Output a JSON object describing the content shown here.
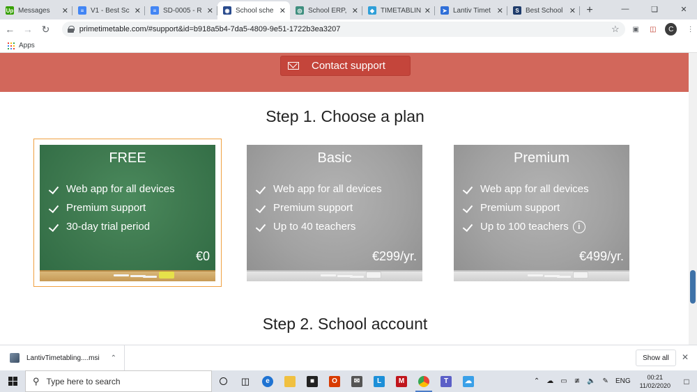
{
  "browser": {
    "tabs": [
      {
        "title": "Messages",
        "icon": "upwork-icon",
        "icon_text": "Up",
        "color": "#37a000",
        "active": false
      },
      {
        "title": "V1 - Best Sc",
        "icon": "google-docs-icon",
        "icon_text": "≡",
        "color": "#4285f4",
        "active": false
      },
      {
        "title": "SD-0005 - R",
        "icon": "google-docs-icon",
        "icon_text": "≡",
        "color": "#4285f4",
        "active": false
      },
      {
        "title": "School sche",
        "icon": "primetimetable-icon",
        "icon_text": "◉",
        "color": "#2a4b8d",
        "active": true
      },
      {
        "title": "School ERP,",
        "icon": "globe-icon",
        "icon_text": "◎",
        "color": "#3f8f7f",
        "active": false
      },
      {
        "title": "TIMETABLIN",
        "icon": "diamond-icon",
        "icon_text": "◆",
        "color": "#2f9fd8",
        "active": false
      },
      {
        "title": "Lantiv Timet",
        "icon": "lantiv-icon",
        "icon_text": "➤",
        "color": "#2f6fd8",
        "active": false
      },
      {
        "title": "Best School",
        "icon": "s-icon",
        "icon_text": "S",
        "color": "#1f3c6b",
        "active": false
      }
    ],
    "new_tab_label": "+",
    "url": "primetimetable.com/#support&id=b918a5b4-7da5-4809-9e51-1722b3ea3207",
    "profile_initial": "C",
    "bookmarks": {
      "apps_label": "Apps"
    }
  },
  "page": {
    "contact_button": "Contact support",
    "step1_title": "Step 1. Choose a plan",
    "step2_title": "Step 2. School account",
    "plans": [
      {
        "name": "FREE",
        "features": [
          "Web app for all devices",
          "Premium support",
          "30-day trial period"
        ],
        "price": "€0",
        "selected": true,
        "style": "green"
      },
      {
        "name": "Basic",
        "features": [
          "Web app for all devices",
          "Premium support",
          "Up to 40 teachers"
        ],
        "price": "€299/yr.",
        "selected": false,
        "style": "gray"
      },
      {
        "name": "Premium",
        "features": [
          "Web app for all devices",
          "Premium support",
          "Up to 100 teachers"
        ],
        "price": "€499/yr.",
        "selected": false,
        "style": "gray",
        "info_icon": "i"
      }
    ]
  },
  "downloads": {
    "file_name": "LantivTimetabling....msi",
    "show_all_label": "Show all"
  },
  "taskbar": {
    "search_placeholder": "Type here to search",
    "language": "ENG",
    "time": "00:21",
    "date": "11/02/2020"
  }
}
